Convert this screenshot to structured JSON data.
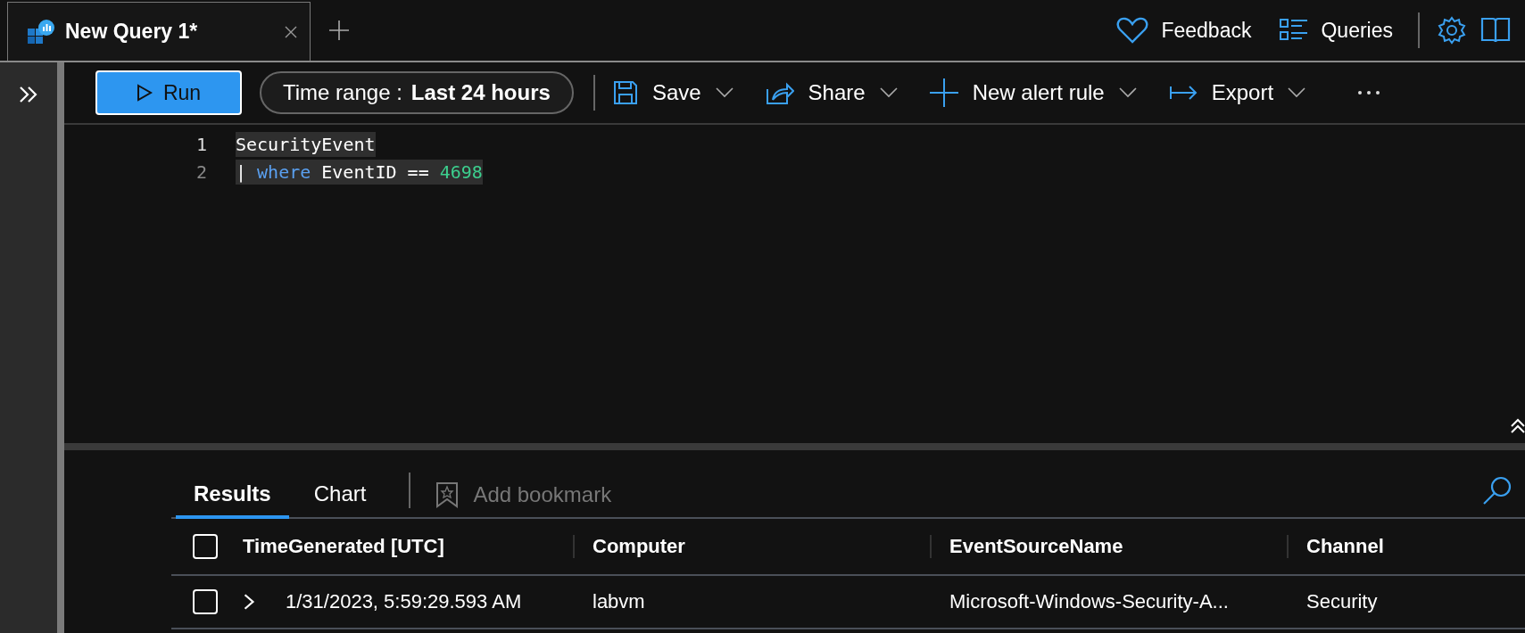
{
  "tabs": [
    {
      "title": "New Query 1*",
      "selected": true
    }
  ],
  "header_actions": [
    {
      "label": "Feedback",
      "kind": "heart"
    },
    {
      "label": "Queries",
      "kind": "list"
    }
  ],
  "toolbar": {
    "run": "Run",
    "time_range": {
      "label": "Time range :",
      "value": "Last 24 hours"
    },
    "actions": [
      {
        "label": "Save",
        "kind": "save"
      },
      {
        "label": "Share",
        "kind": "share"
      },
      {
        "label": "New alert rule",
        "kind": "plus"
      },
      {
        "label": "Export",
        "kind": "export"
      }
    ]
  },
  "editor": {
    "lines": [
      {
        "number": "1",
        "tokens": [
          {
            "text": "SecurityEvent",
            "kind": "plain"
          }
        ]
      },
      {
        "number": "2",
        "tokens": [
          {
            "text": "|",
            "kind": "plain"
          },
          {
            "text": "where",
            "kind": "keyword"
          },
          {
            "text": "EventID ==",
            "kind": "plain"
          },
          {
            "text": "4698",
            "kind": "number"
          }
        ]
      }
    ]
  },
  "results": {
    "tabs": [
      {
        "label": "Results",
        "selected": true
      },
      {
        "label": "Chart",
        "selected": false
      }
    ],
    "bookmark": {
      "label": "Add bookmark",
      "disabled": true
    },
    "select_all": {
      "checked": false
    },
    "columns": [
      "TimeGenerated [UTC]",
      "Computer",
      "EventSourceName",
      "Channel"
    ],
    "rows": [
      {
        "checked": false,
        "expanded": false,
        "cells": [
          "1/31/2023, 5:59:29.593 AM",
          "labvm",
          "Microsoft-Windows-Security-A...",
          "Security"
        ]
      }
    ]
  }
}
